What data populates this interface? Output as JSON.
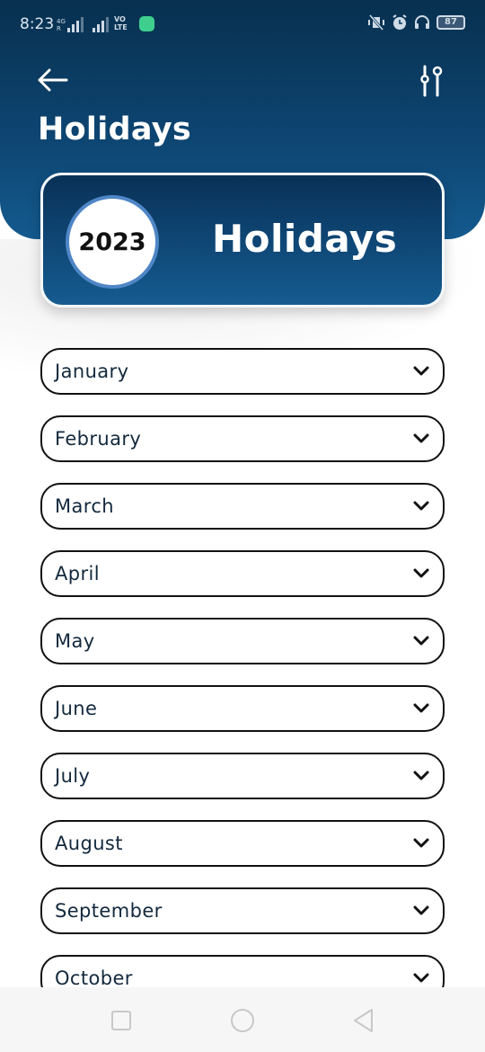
{
  "status_bar": {
    "time": "8:23",
    "network_label": "4G",
    "roaming": "R",
    "volte_line1": "VO",
    "volte_line2": "LTE",
    "battery": "87"
  },
  "header": {
    "back_icon": "arrow-left-icon",
    "filter_icon": "sliders-icon",
    "title": "Holidays"
  },
  "banner": {
    "year": "2023",
    "title": "Holidays"
  },
  "months": [
    {
      "label": "January"
    },
    {
      "label": "February"
    },
    {
      "label": "March"
    },
    {
      "label": "April"
    },
    {
      "label": "May"
    },
    {
      "label": "June"
    },
    {
      "label": "July"
    },
    {
      "label": "August"
    },
    {
      "label": "September"
    },
    {
      "label": "October"
    }
  ],
  "nav_bar": {
    "recents_icon": "square-icon",
    "home_icon": "circle-icon",
    "back_icon": "triangle-back-icon"
  },
  "colors": {
    "header_dark": "#08304f",
    "header_light": "#145a8e",
    "year_ring": "#4f86c6",
    "month_text": "#13293d"
  }
}
